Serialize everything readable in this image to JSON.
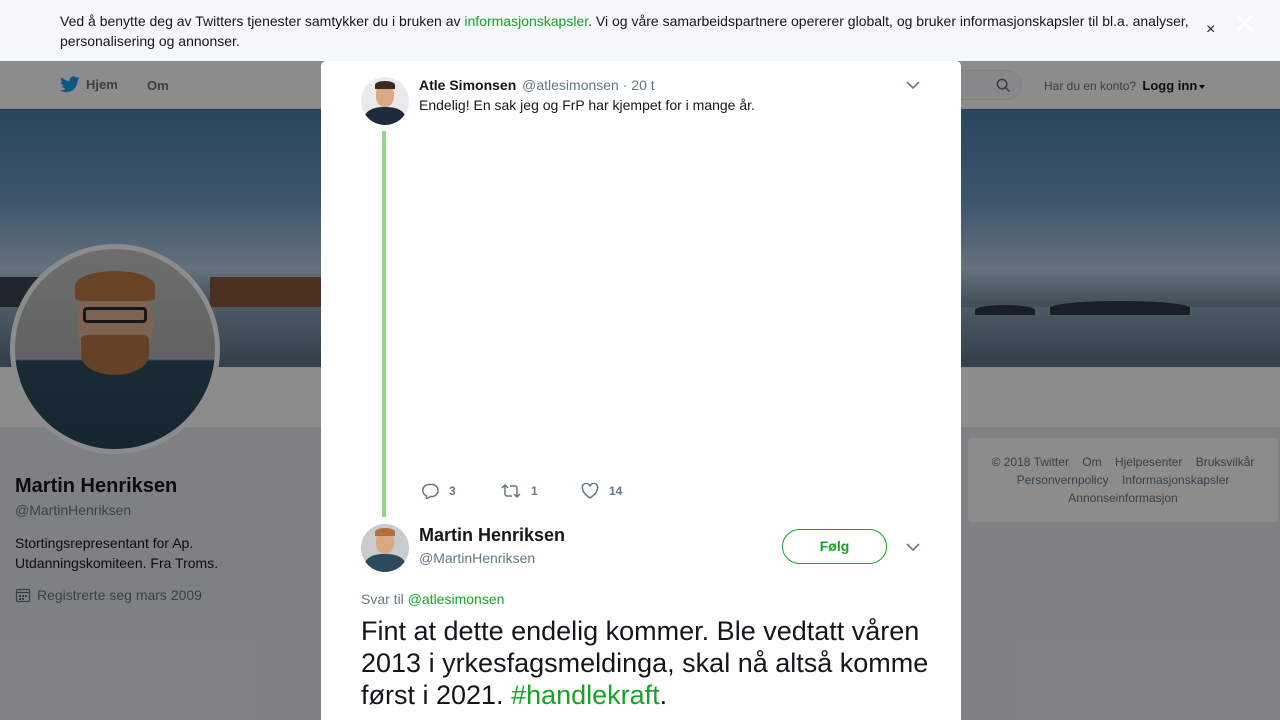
{
  "cookie_banner": {
    "text_before": "Ved å benytte deg av Twitters tjenester samtykker du i bruken av ",
    "link": "informasjonskapsler",
    "text_after": ". Vi og våre samarbeidspartnere opererer globalt, og bruker informasjonskapsler til bl.a. analyser, personalisering og annonser.",
    "close": "×"
  },
  "modal_close": "✕",
  "nav": {
    "home": "Hjem",
    "about": "Om",
    "account_prompt": "Har du en konto?",
    "login": "Logg inn"
  },
  "profile": {
    "name": "Martin Henriksen",
    "handle": "@MartinHenriksen",
    "bio": "Stortingsrepresentant for Ap. Utdanningskomiteen. Fra Troms.",
    "joined": "Registrerte seg mars 2009"
  },
  "footer": {
    "links": [
      "© 2018 Twitter",
      "Om",
      "Hjelpesenter",
      "Bruksvilkår",
      "Personvernpolicy",
      "Informasjonskapsler",
      "Annonseinformasjon"
    ]
  },
  "parent_tweet": {
    "name": "Atle Simonsen",
    "handle": "@atlesimonsen",
    "separator": "·",
    "time": "20 t",
    "text": "Endelig! En sak jeg og FrP har kjempet for i mange år.",
    "replies": "3",
    "retweets": "1",
    "likes": "14"
  },
  "main_tweet": {
    "name": "Martin Henriksen",
    "handle": "@MartinHenriksen",
    "follow": "Følg",
    "reply_prefix": "Svar til",
    "reply_to": "@atlesimonsen",
    "text": "Fint at dette endelig kommer. Ble vedtatt våren 2013 i yrkesfagsmeldinga, skal nå altså komme først i 2021. ",
    "hashtag": "#handlekraft",
    "text_end": "."
  },
  "colors": {
    "accent": "#17a325",
    "thread_line": "#8cd98c",
    "muted": "#657786"
  },
  "icons": [
    "twitter-bird-icon",
    "search-icon",
    "calendar-icon",
    "reply-icon",
    "retweet-icon",
    "like-icon",
    "chevron-down-icon",
    "close-icon"
  ]
}
